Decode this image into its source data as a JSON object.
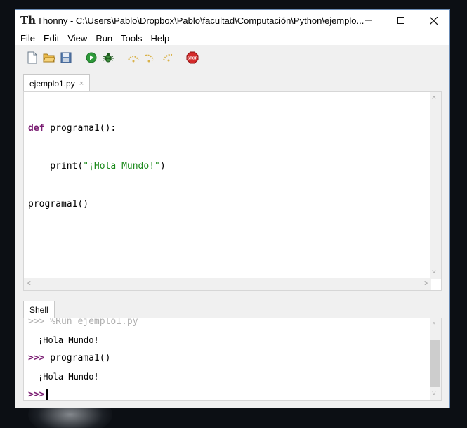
{
  "window": {
    "app_name": "Thonny",
    "title": "Thonny  -  C:\\Users\\Pablo\\Dropbox\\Pablo\\facultad\\Computación\\Python\\ejemplo..."
  },
  "menu": {
    "items": [
      {
        "label": "File"
      },
      {
        "label": "Edit"
      },
      {
        "label": "View"
      },
      {
        "label": "Run"
      },
      {
        "label": "Tools"
      },
      {
        "label": "Help"
      }
    ]
  },
  "toolbar": {
    "buttons": [
      {
        "name": "new-file-icon"
      },
      {
        "name": "open-file-icon"
      },
      {
        "name": "save-file-icon"
      },
      {
        "name": "run-icon"
      },
      {
        "name": "debug-icon"
      },
      {
        "name": "step-over-icon"
      },
      {
        "name": "step-into-icon"
      },
      {
        "name": "step-out-icon"
      },
      {
        "name": "stop-icon",
        "text": "STOP"
      }
    ]
  },
  "editor": {
    "tab_label": "ejemplo1.py",
    "tab_close": "×",
    "lines": [
      {
        "kw": "def",
        "rest": " programa1():"
      },
      {
        "pre": "    print(",
        "str": "\"¡Hola Mundo!\"",
        "post": ")"
      },
      {
        "pre": "programa1()"
      }
    ]
  },
  "shell": {
    "tab_label": "Shell",
    "lines": [
      {
        "prompt": ">>>",
        "text": " %Run ejemplo1.py"
      },
      {
        "output": "¡Hola Mundo!"
      },
      {
        "prompt": ">>>",
        "text": " programa1()"
      },
      {
        "output": "¡Hola Mundo!"
      },
      {
        "prompt": ">>>",
        "text": ""
      }
    ]
  },
  "colors": {
    "keyword": "#7a1c72",
    "string": "#1b8a1b",
    "window_border": "#6a8bb5"
  }
}
